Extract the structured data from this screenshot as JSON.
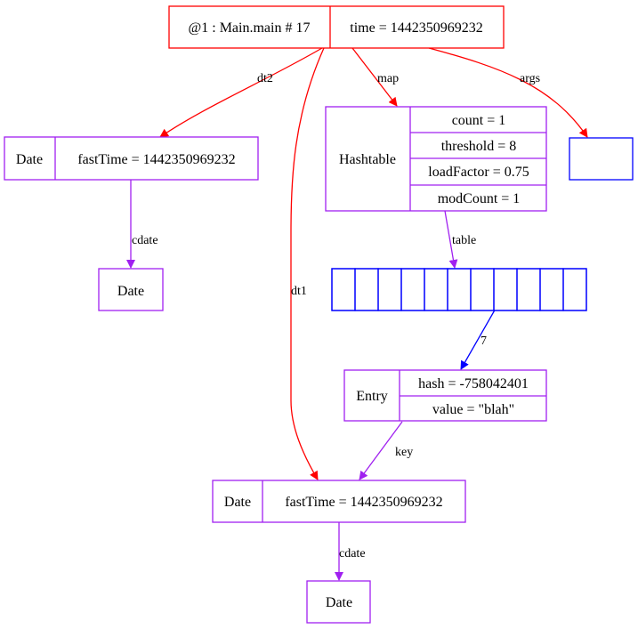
{
  "colors": {
    "red": "#ff0000",
    "purple": "#a020f0",
    "blue": "#0000ff"
  },
  "nodes": {
    "main": {
      "left": "@1 : Main.main # 17",
      "right": "time = 1442350969232"
    },
    "date_dt2": {
      "type": "Date",
      "field": "fastTime = 1442350969232"
    },
    "date_dt2_cdate": {
      "type": "Date"
    },
    "hashtable": {
      "type": "Hashtable",
      "fields": [
        "count = 1",
        "threshold = 8",
        "loadFactor = 0.75",
        "modCount = 1"
      ]
    },
    "args_array": {
      "cells": 1
    },
    "table_array": {
      "cells": 11,
      "filled_index": 7
    },
    "entry": {
      "type": "Entry",
      "fields": [
        "hash = -758042401",
        "value = \"blah\""
      ]
    },
    "date_dt1": {
      "type": "Date",
      "field": "fastTime = 1442350969232"
    },
    "date_dt1_cdate": {
      "type": "Date"
    }
  },
  "edges": {
    "dt2": "dt2",
    "map": "map",
    "args": "args",
    "dt1": "dt1",
    "cdate_top": "cdate",
    "table": "table",
    "index": "7",
    "key": "key",
    "cdate_bottom": "cdate"
  }
}
